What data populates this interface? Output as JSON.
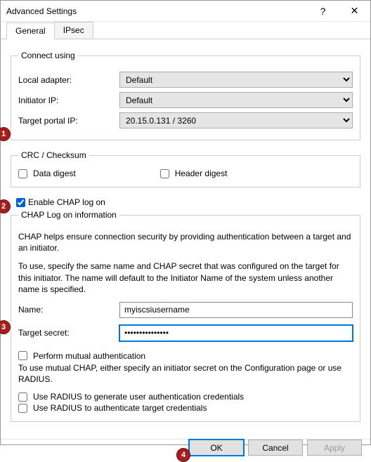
{
  "title": "Advanced Settings",
  "tabs": {
    "general": "General",
    "ipsec": "IPsec"
  },
  "connect_using": {
    "legend": "Connect using",
    "local_adapter_label": "Local adapter:",
    "local_adapter_value": "Default",
    "initiator_ip_label": "Initiator IP:",
    "initiator_ip_value": "Default",
    "target_portal_ip_label": "Target portal IP:",
    "target_portal_ip_value": "20.15.0.131 / 3260"
  },
  "crc": {
    "legend": "CRC / Checksum",
    "data_digest_label": "Data digest",
    "header_digest_label": "Header digest"
  },
  "chap": {
    "enable_label": "Enable CHAP log on",
    "legend": "CHAP Log on information",
    "desc1": "CHAP helps ensure connection security by providing authentication between a target and an initiator.",
    "desc2": "To use, specify the same name and CHAP secret that was configured on the target for this initiator.  The name will default to the Initiator Name of the system unless another name is specified.",
    "name_label": "Name:",
    "name_value": "myiscsiusername",
    "target_secret_label": "Target secret:",
    "target_secret_value": "•••••••••••••••",
    "mutual_label": "Perform mutual authentication",
    "mutual_desc": "To use mutual CHAP, either specify an initiator secret on the Configuration page or use RADIUS.",
    "radius_gen_label": "Use RADIUS to generate user authentication credentials",
    "radius_auth_label": "Use RADIUS to authenticate target credentials"
  },
  "buttons": {
    "ok": "OK",
    "cancel": "Cancel",
    "apply": "Apply"
  },
  "callouts": {
    "c1": "1",
    "c2": "2",
    "c3": "3",
    "c4": "4"
  }
}
